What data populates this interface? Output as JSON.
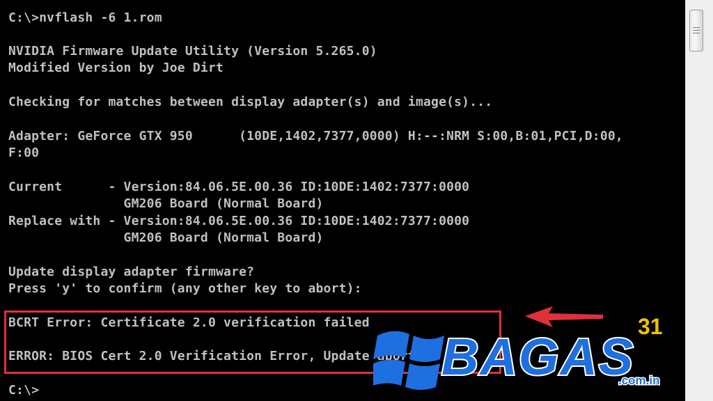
{
  "console": {
    "lines": [
      "C:\\>nvflash -6 1.rom",
      "NVIDIA Firmware Update Utility (Version 5.265.0)",
      "Modified Version by Joe Dirt",
      "Checking for matches between display adapter(s) and image(s)...",
      "Adapter: GeForce GTX 950      (10DE,1402,7377,0000) H:--:NRM S:00,B:01,PCI,D:00,",
      "F:00",
      "Current      - Version:84.06.5E.00.36 ID:10DE:1402:7377:0000",
      "               GM206 Board (Normal Board)",
      "Replace with - Version:84.06.5E.00.36 ID:10DE:1402:7377:0000",
      "               GM206 Board (Normal Board)",
      "Update display adapter firmware?",
      "Press 'y' to confirm (any other key to abort):",
      "BCRT Error: Certificate 2.0 verification failed",
      "ERROR: BIOS Cert 2.0 Verification Error, Update aborted",
      "C:\\>"
    ]
  },
  "watermark": {
    "brand": "BAGAS",
    "superscript": "31",
    "domain": ".com.in",
    "logo_icon": "windows-flag-icon",
    "arrow_icon": "arrow-left-icon"
  },
  "colors": {
    "console_text": "#c0c0c0",
    "console_bg": "#000000",
    "highlight_border": "#e0303a",
    "watermark_blue": "#1e6fe0",
    "watermark_yellow": "#f2c100"
  }
}
